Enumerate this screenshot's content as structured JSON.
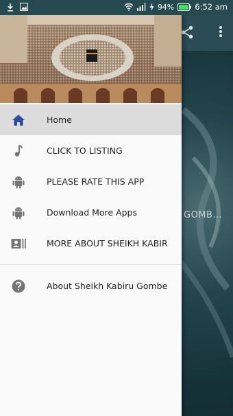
{
  "status_bar": {
    "battery_percent": "94%",
    "time": "6:52",
    "time_suffix": "am"
  },
  "background": {
    "partial_title": "GOMB..."
  },
  "drawer": {
    "items": [
      {
        "label": "Home",
        "icon": "home-icon",
        "active": true
      },
      {
        "label": "CLICK TO LISTING",
        "icon": "music-note-icon",
        "active": false
      },
      {
        "label": "PLEASE RATE THIS APP",
        "icon": "android-icon",
        "active": false
      },
      {
        "label": "Download More Apps",
        "icon": "android-icon",
        "active": false
      },
      {
        "label": "MORE ABOUT SHEIKH KABIR",
        "icon": "contact-card-icon",
        "active": false
      }
    ],
    "secondary_items": [
      {
        "label": "About Sheikh Kabiru Gombe",
        "icon": "help-icon"
      }
    ]
  },
  "colors": {
    "accent": "#2d4a9e",
    "status_bar": "#274950",
    "icon_grey": "#757575"
  }
}
